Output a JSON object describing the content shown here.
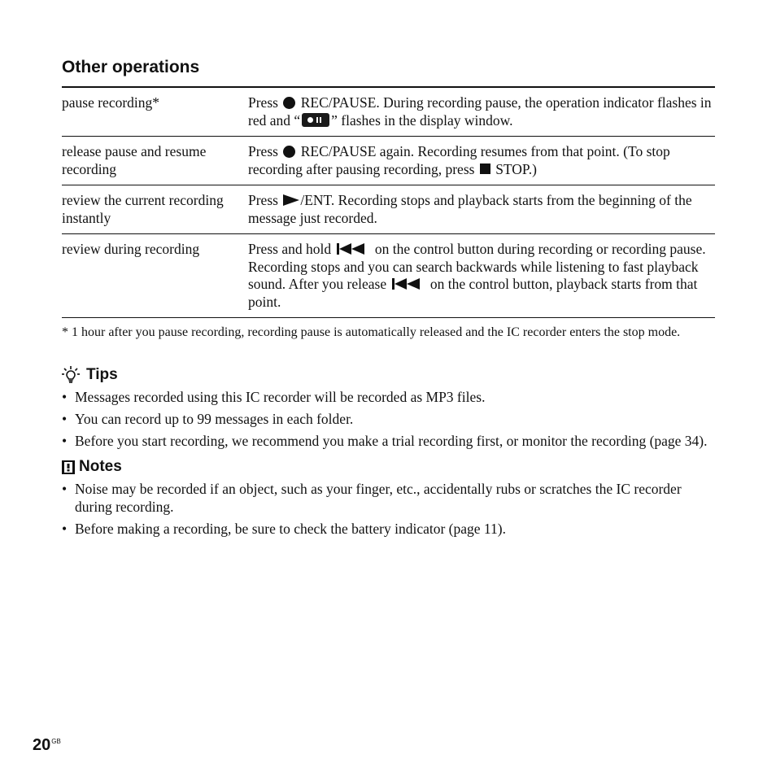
{
  "section_title": "Other operations",
  "operations": [
    {
      "operation": "pause recording*",
      "desc_parts": [
        "Press",
        "REC/PAUSE. During recording pause, the operation indicator flashes in red and “",
        "” flashes in the display window."
      ]
    },
    {
      "operation": "release pause and resume recording",
      "desc_parts": [
        "Press",
        "REC/PAUSE again. Recording resumes from that point. (To stop recording after pausing recording, press",
        "STOP.)"
      ]
    },
    {
      "operation": "review the current recording instantly",
      "desc_parts": [
        "Press",
        "/ENT. Recording stops and playback starts from the beginning of the message just recorded."
      ]
    },
    {
      "operation": "review during recording",
      "desc_parts": [
        "Press and hold",
        "on the control button during recording or recording pause. Recording stops and you can search backwards while listening to fast playback sound. After you release",
        "on the control button, playback starts from that point."
      ]
    }
  ],
  "footnote": "* 1 hour after you pause recording, recording pause is automatically released and the IC recorder enters the stop mode.",
  "tips": {
    "heading": "Tips",
    "icon": "lightbulb-icon",
    "items": [
      "Messages recorded using this IC recorder will be recorded as MP3 files.",
      "You can record up to 99 messages in each folder.",
      "Before you start recording, we recommend you make a trial recording first, or monitor the recording (page 34)."
    ]
  },
  "notes": {
    "heading": "Notes",
    "icon": "exclamation-box-icon",
    "items": [
      "Noise may be recorded if an object, such as your finger, etc., accidentally rubs or scratches the IC recorder during recording.",
      "Before making a recording, be sure to check the battery indicator (page 11)."
    ]
  },
  "page_number": "20",
  "page_suffix": "GB"
}
